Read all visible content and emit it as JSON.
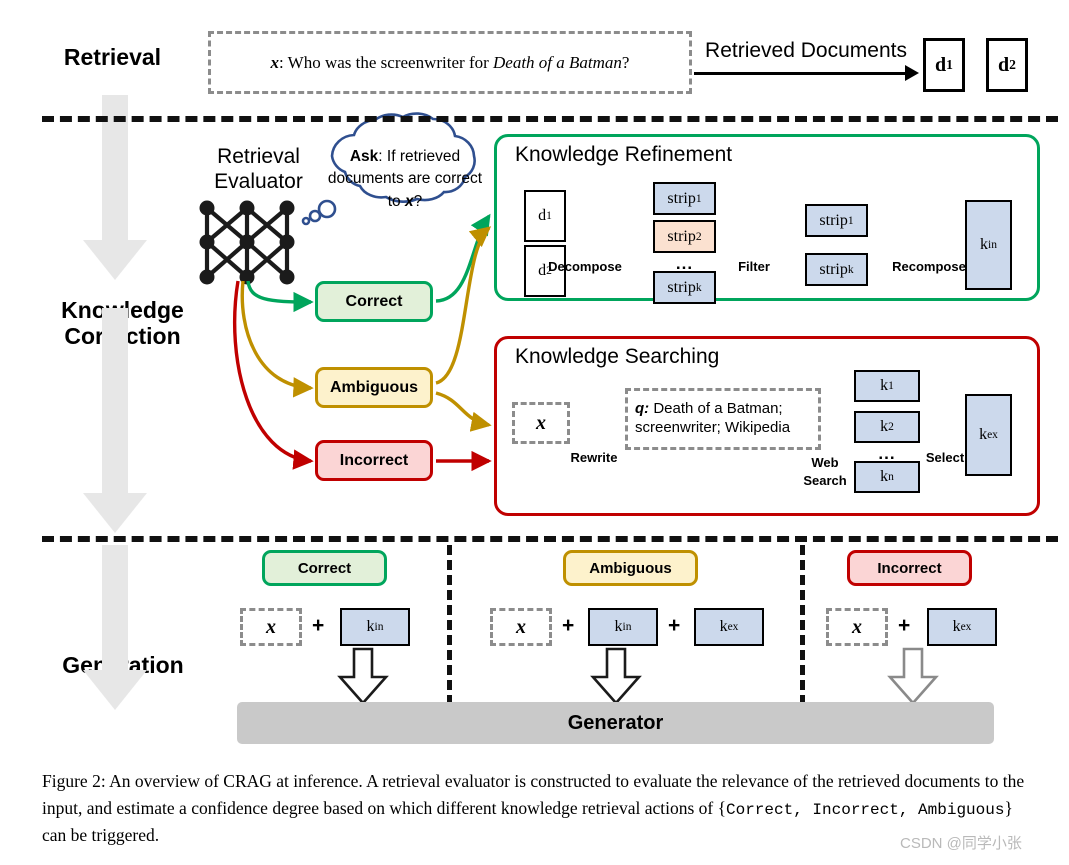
{
  "figure": {
    "caption_line1": "Figure 2: An overview of CRAG at inference. A retrieval evaluator is constructed to evaluate the relevance of the",
    "caption_line2": "retrieved documents to the input, and estimate a confidence degree based on which different knowledge retrieval",
    "caption_line3_pre": "actions of {",
    "caption_mono": "Correct, Incorrect, Ambiguous",
    "caption_line3_post": "} can be triggered.",
    "watermark": "CSDN @同学小张"
  },
  "stages": {
    "retrieval": "Retrieval",
    "knowledge_correction": "Knowledge\nCorrection",
    "generation": "Generation"
  },
  "retrieval": {
    "question_prefix": "x",
    "question_colon": ": Who was the screenwriter for ",
    "question_italic": "Death of a Batman",
    "question_suffix": "?",
    "retrieved_documents_label": "Retrieved Documents",
    "doc1": "d",
    "doc1_sub": "1",
    "doc2": "d",
    "doc2_sub": "2"
  },
  "evaluator": {
    "title": "Retrieval\nEvaluator",
    "bubble_prefix": "Ask",
    "bubble_text": ": If retrieved documents are correct to ",
    "bubble_var": "x",
    "bubble_suffix": "?"
  },
  "decisions": {
    "correct": "Correct",
    "ambiguous": "Ambiguous",
    "incorrect": "Incorrect"
  },
  "knowledge_refinement": {
    "title": "Knowledge Refinement",
    "doc1": "d",
    "doc1_sub": "1",
    "doc2": "d",
    "doc2_sub": "2",
    "op_decompose": "Decompose",
    "op_filter": "Filter",
    "op_recompose": "Recompose",
    "strips_in": [
      {
        "label": "strip",
        "sub": "1",
        "color": "blue"
      },
      {
        "label": "strip",
        "sub": "2",
        "color": "peach"
      },
      {
        "label": "strip",
        "sub": "k",
        "color": "blue"
      }
    ],
    "strips_out": [
      {
        "label": "strip",
        "sub": "1",
        "color": "blue"
      },
      {
        "label": "strip",
        "sub": "k",
        "color": "blue"
      }
    ],
    "ellipsis": "...",
    "result": "k",
    "result_sub": "in"
  },
  "knowledge_searching": {
    "title": "Knowledge Searching",
    "input_x": "x",
    "op_rewrite": "Rewrite",
    "query_prefix": "q:",
    "query_text": "Death of a Batman; screenwriter; Wikipedia",
    "op_web_search": "Web\nSearch",
    "op_select": "Select",
    "results": [
      {
        "label": "k",
        "sub": "1"
      },
      {
        "label": "k",
        "sub": "2"
      },
      {
        "label": "k",
        "sub": "n"
      }
    ],
    "ellipsis": "...",
    "result": "k",
    "result_sub": "ex"
  },
  "generation": {
    "columns": [
      {
        "pill": "Correct",
        "pill_fill": "#e2f0d9",
        "pill_border": "#00a55c",
        "items": [
          "x",
          "k_in"
        ]
      },
      {
        "pill": "Ambiguous",
        "pill_fill": "#fdf2cc",
        "pill_border": "#bf9000",
        "items": [
          "x",
          "k_in",
          "k_ex"
        ]
      },
      {
        "pill": "Incorrect",
        "pill_fill": "#fbd5d5",
        "pill_border": "#c00000",
        "items": [
          "x",
          "k_ex"
        ]
      }
    ],
    "plus": "+",
    "x_label": "x",
    "k_in": "k",
    "k_in_sub": "in",
    "k_ex": "k",
    "k_ex_sub": "ex",
    "generator": "Generator"
  },
  "colors": {
    "correct": "#00a55c",
    "ambiguous": "#bf9000",
    "incorrect": "#c00000",
    "blue_fill": "#ccd9ec",
    "peach_fill": "#fbe1d0",
    "gray_arrow": "#e7e7e7",
    "generator_bar": "#c9c9c9",
    "bubble_stroke": "#2f4f8f",
    "globe": "#4472c4",
    "magnifier": "#e8a33d"
  }
}
